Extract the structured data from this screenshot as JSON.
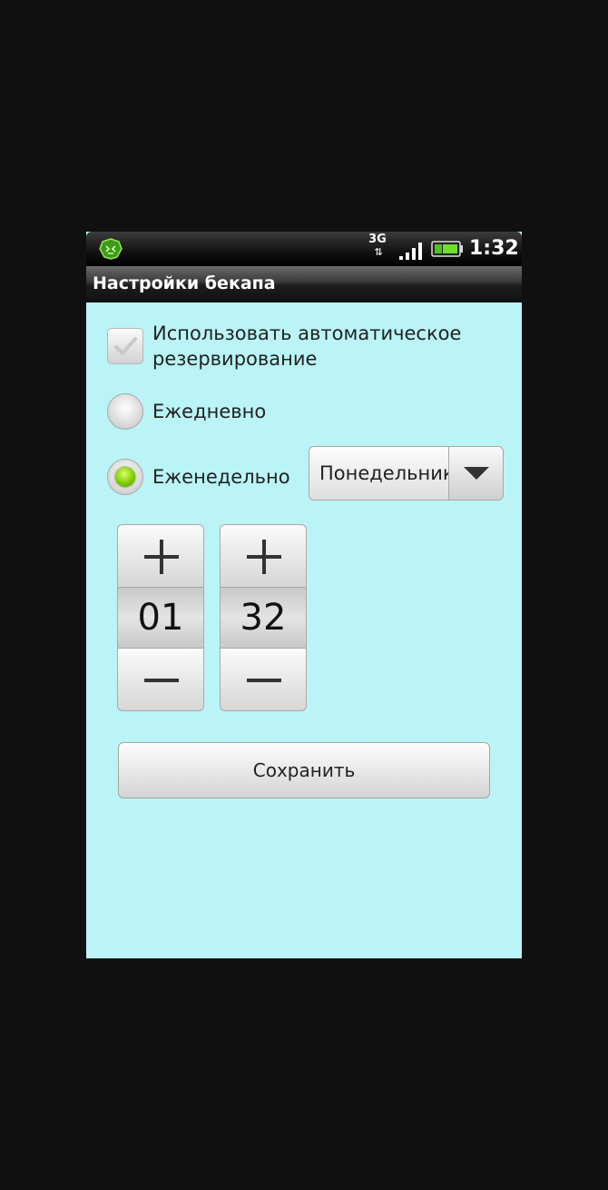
{
  "status_bar": {
    "app_icon": "green-app-icon",
    "network_label": "3G",
    "network_arrows": "⇅",
    "signal_icon": "signal-bars-icon",
    "battery_icon": "battery-icon",
    "time": "1:32"
  },
  "title_bar": {
    "title": "Настройки бекапа"
  },
  "settings": {
    "auto_backup": {
      "label": "Использовать автоматическое резервирование",
      "checked": true
    },
    "schedule": {
      "daily_label": "Ежедневно",
      "weekly_label": "Еженедельно",
      "selected": "weekly"
    },
    "weekday_dropdown": {
      "selected_value": "Понедельник",
      "icon": "dropdown-arrow-icon"
    },
    "time_picker": {
      "hours": "01",
      "minutes": "32",
      "increment_icon": "plus-icon",
      "decrement_icon": "minus-icon"
    },
    "save_label": "Сохранить"
  },
  "colors": {
    "background": "#baf4f6",
    "radio_selected": "#7fcf00"
  }
}
